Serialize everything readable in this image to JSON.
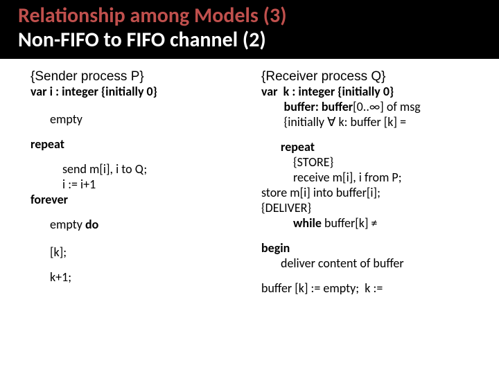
{
  "title": {
    "line1": "Relationship among Models (3)",
    "line2": "Non-FIFO to FIFO channel (2)"
  },
  "left": {
    "header": "{Sender process P}",
    "decl": "var i : integer {initially 0}",
    "empty": "empty",
    "repeat": "repeat",
    "b1": "send m[i], i to Q;",
    "b2": "i := i+1",
    "forever": "forever",
    "emptydo_a": "empty ",
    "emptydo_b": "do",
    "bracket_k": "[k];",
    "kplus": "k+1;"
  },
  "right": {
    "header": "{Receiver process Q}",
    "decl1": "var  k : integer {initially 0}",
    "decl2a": "        buffer: ",
    "decl2b": "buffer",
    "decl2c": "[0..∞] of msg",
    "decl3": "        {initially ∀ k: buffer [k] =",
    "repeat": "repeat",
    "store": "{STORE}",
    "b1": "receive m[i], i from P;",
    "b2": "store m[i] into buffer[i];",
    "deliver": "{DELIVER}",
    "whilea": "while",
    "whileb": " buffer[k] ≠",
    "begin": "begin",
    "begin1": "deliver content of buffer",
    "last": "buffer [k] := empty;  k :="
  }
}
